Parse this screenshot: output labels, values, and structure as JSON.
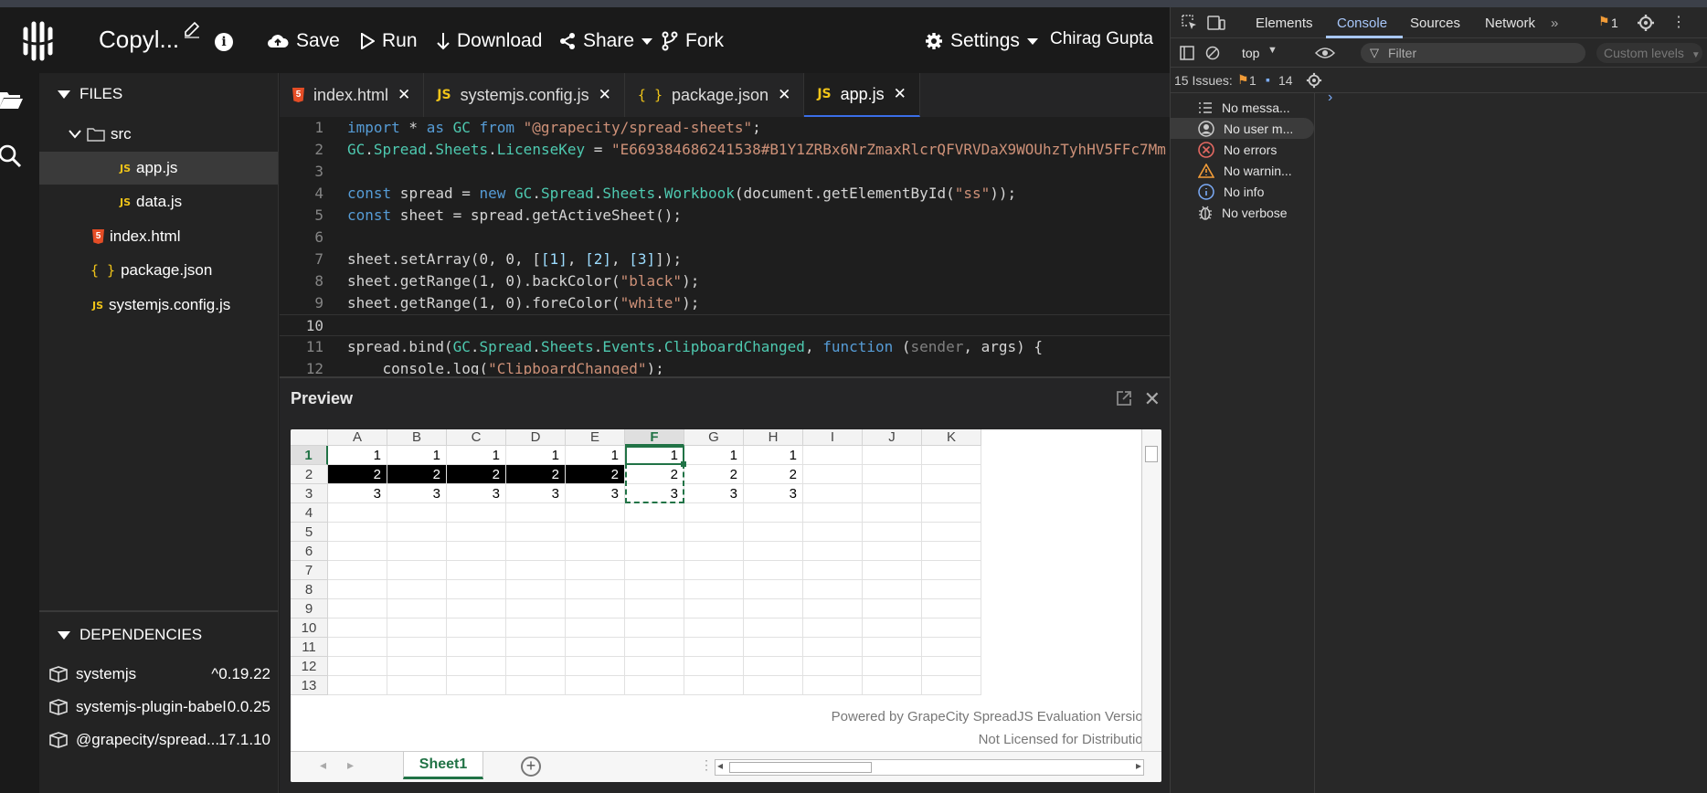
{
  "app": {
    "project_title": "Copyl...",
    "toolbar": {
      "save": "Save",
      "run": "Run",
      "download": "Download",
      "share": "Share",
      "fork": "Fork",
      "settings": "Settings"
    },
    "user": "Chirag Gupta"
  },
  "files": {
    "header": "FILES",
    "folder": "src",
    "items": [
      {
        "badge": "JS",
        "name": "app.js"
      },
      {
        "badge": "JS",
        "name": "data.js"
      },
      {
        "badge": "html",
        "name": "index.html"
      },
      {
        "badge": "{ }",
        "name": "package.json"
      },
      {
        "badge": "JS",
        "name": "systemjs.config.js"
      }
    ]
  },
  "dependencies": {
    "header": "DEPENDENCIES",
    "items": [
      {
        "name": "systemjs",
        "version": "^0.19.22"
      },
      {
        "name": "systemjs-plugin-babel",
        "version": "0.0.25"
      },
      {
        "name": "@grapecity/spread...",
        "version": "17.1.10"
      }
    ]
  },
  "editor": {
    "tabs": [
      {
        "badge": "html",
        "label": "index.html"
      },
      {
        "badge": "JS",
        "label": "systemjs.config.js"
      },
      {
        "badge": "{ }",
        "label": "package.json"
      },
      {
        "badge": "JS",
        "label": "app.js"
      }
    ],
    "active_tab": "app.js",
    "lines": [
      {
        "n": "1",
        "code": "import * as GC from \"@grapecity/spread-sheets\";"
      },
      {
        "n": "2",
        "code": "GC.Spread.Sheets.LicenseKey = \"E669384686241538#B1Y1ZRBx6NrZmaxRlcrQFVRVDaX9WOUhzTyhHV5FFc7Mm"
      },
      {
        "n": "3",
        "code": ""
      },
      {
        "n": "4",
        "code": "const spread = new GC.Spread.Sheets.Workbook(document.getElementById(\"ss\"));"
      },
      {
        "n": "5",
        "code": "const sheet = spread.getActiveSheet();"
      },
      {
        "n": "6",
        "code": ""
      },
      {
        "n": "7",
        "code": "sheet.setArray(0, 0, [[1], [2], [3]]);"
      },
      {
        "n": "8",
        "code": "sheet.getRange(1, 0).backColor(\"black\");"
      },
      {
        "n": "9",
        "code": "sheet.getRange(1, 0).foreColor(\"white\");"
      },
      {
        "n": "10",
        "code": ""
      },
      {
        "n": "11",
        "code": "spread.bind(GC.Spread.Sheets.Events.ClipboardChanged, function (sender, args) {"
      },
      {
        "n": "12",
        "code": "    console.log(\"ClipboardChanged\");"
      }
    ]
  },
  "preview": {
    "title": "Preview",
    "columns": [
      "A",
      "B",
      "C",
      "D",
      "E",
      "F",
      "G",
      "H",
      "I",
      "J",
      "K"
    ],
    "selected_column": "F",
    "row_numbers": [
      "1",
      "2",
      "3",
      "4",
      "5",
      "6",
      "7",
      "8",
      "9",
      "10",
      "11",
      "12",
      "13"
    ],
    "rows": [
      [
        "1",
        "1",
        "1",
        "1",
        "1",
        "1",
        "1",
        "1",
        "",
        "",
        ""
      ],
      [
        "2",
        "2",
        "2",
        "2",
        "2",
        "2",
        "2",
        "2",
        "",
        "",
        ""
      ],
      [
        "3",
        "3",
        "3",
        "3",
        "3",
        "3",
        "3",
        "3",
        "",
        "",
        ""
      ]
    ],
    "dark_row": 1,
    "dark_cols": 5,
    "watermark_line1": "Powered by GrapeCity SpreadJS Evaluation Version",
    "watermark_line2": "Not Licensed for Distribution",
    "sheet_tab": "Sheet1"
  },
  "devtools": {
    "tabs": [
      "Elements",
      "Console",
      "Sources",
      "Network"
    ],
    "active_tab": "Console",
    "issue_badge": "1",
    "context": "top",
    "filter_placeholder": "Filter",
    "levels": "Custom levels",
    "issues_label": "15 Issues:",
    "issues_warn": "1",
    "issues_info": "14",
    "sidebar": [
      {
        "icon": "list-icon",
        "label": "No messa..."
      },
      {
        "icon": "user-icon",
        "label": "No user m..."
      },
      {
        "icon": "error-icon",
        "label": "No errors"
      },
      {
        "icon": "warning-icon",
        "label": "No warnin..."
      },
      {
        "icon": "info-icon",
        "label": "No info"
      },
      {
        "icon": "bug-icon",
        "label": "No verbose"
      }
    ]
  },
  "colors": {
    "accent": "#a8c7fa",
    "sheet_green": "#217346",
    "error": "#e46962",
    "warning": "#f29c38"
  }
}
